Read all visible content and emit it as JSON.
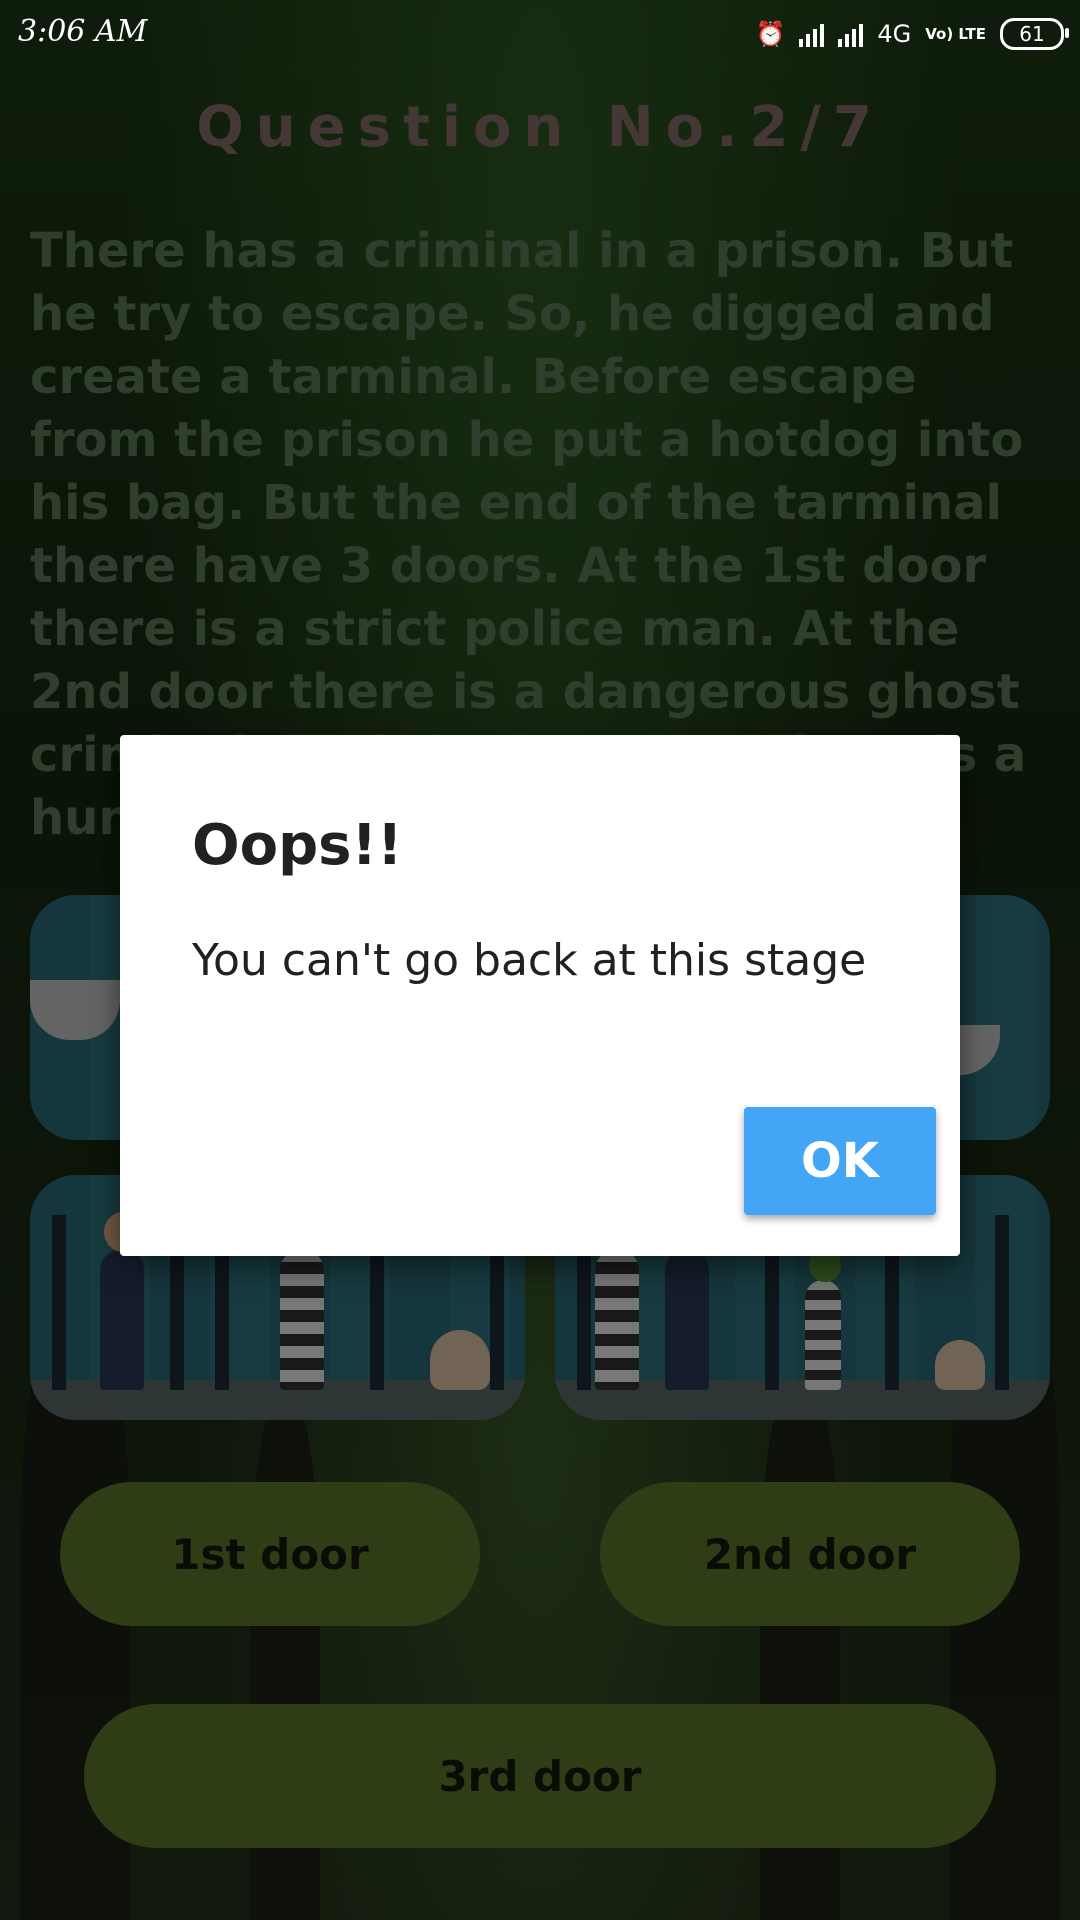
{
  "status_bar": {
    "time": "3:06 AM",
    "network": "4G",
    "volte": "Vo) LTE",
    "battery": "61"
  },
  "question": {
    "title": "Question No.2/7",
    "text": "There has a criminal in a prison. But he try to escape. So, he digged and create a tarminal. Before escape from the prison he put a hotdog into his bag. But the end of the tarminal there have 3 doors. At the 1st door there is a strict police man. At the 2nd door there is a dangerous ghost criminal. And the last door there is a hun... the \"cri..."
  },
  "doors": {
    "first": "1st door",
    "second": "2nd door",
    "third": "3rd door"
  },
  "dialog": {
    "title": "Oops!!",
    "message": "You can't go back at this stage",
    "ok_label": "OK"
  },
  "colors": {
    "door_button": "#5d7a2c",
    "ok_button": "#42a5f5",
    "question_title": "#8b6f6a",
    "question_text": "#5f7d5a"
  }
}
